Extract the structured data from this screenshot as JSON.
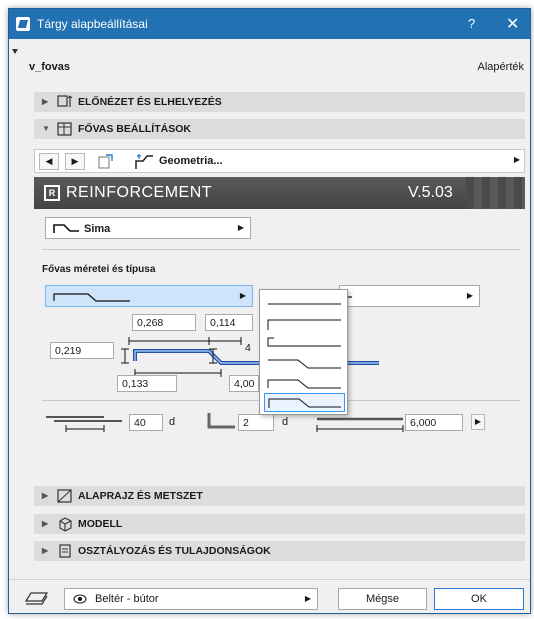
{
  "window": {
    "title": "Tárgy alapbeállításai",
    "help": "?",
    "close": "✕"
  },
  "object": {
    "name": "v_fovas",
    "default_link": "Alapérték"
  },
  "sections": {
    "preview": "ELŐNÉZET ÉS ELHELYEZÉS",
    "main_bar": "FŐVAS BEÁLLÍTÁSOK",
    "floorplan": "ALAPRAJZ ÉS METSZET",
    "model": "MODELL",
    "classification": "OSZTÁLYOZÁS ÉS TULAJDONSÁGOK"
  },
  "nav": {
    "prev": "◀",
    "next": "▶",
    "page": "Geometria...",
    "more": "▶"
  },
  "banner": {
    "logo": "R",
    "brand": "REINFORCEMENT",
    "version": "V.5.03"
  },
  "shape_select": {
    "value": "Sima",
    "arrow": "▶"
  },
  "bar_section": {
    "caption": "Fővas méretei és típusa",
    "arrow": "▶",
    "right_arrow": "▶"
  },
  "dims": {
    "top_left": "0,268",
    "top_right": "0,114",
    "left": "0,219",
    "middle": "4",
    "bottom_left": "0,133",
    "bottom_right": "4,00"
  },
  "anchors": {
    "lap_value": "40",
    "lap_unit": "d",
    "hook_value": "2",
    "hook_unit": "d",
    "length_value": "6,000",
    "length_arrow": "▶"
  },
  "footer": {
    "layer": "Beltér - bútor",
    "layer_arrow": "▶",
    "cancel": "Mégse",
    "ok": "OK"
  }
}
